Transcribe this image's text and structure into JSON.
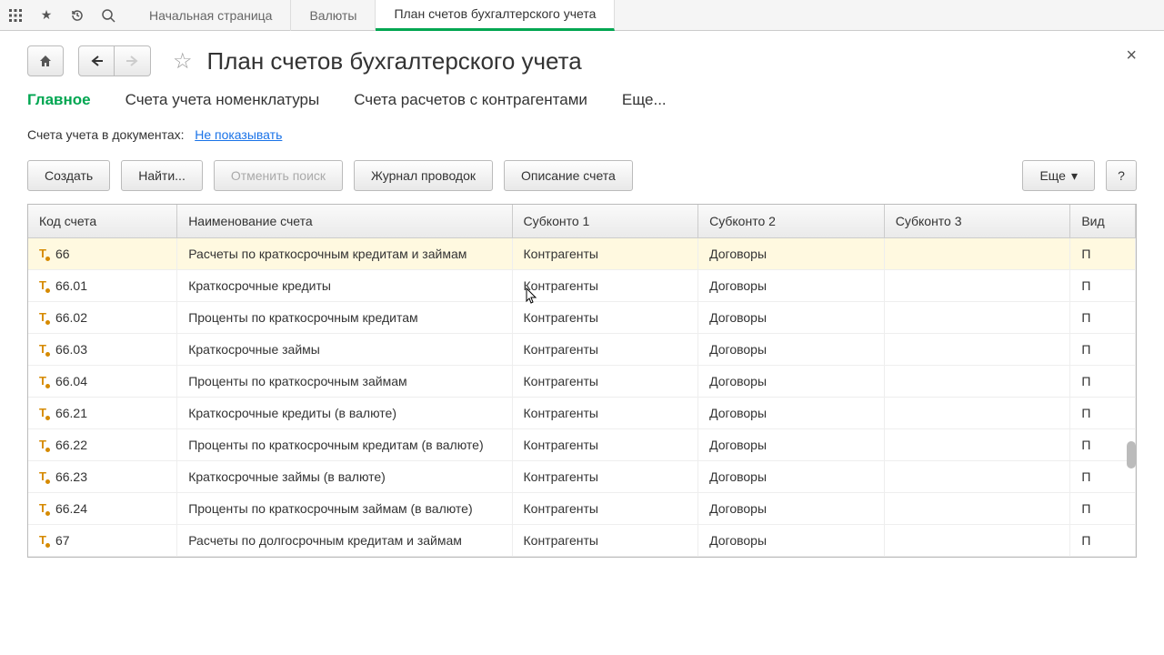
{
  "top_tabs": {
    "home": "Начальная страница",
    "currencies": "Валюты",
    "chart": "План счетов бухгалтерского учета"
  },
  "header": {
    "title": "План счетов бухгалтерского учета"
  },
  "page_tabs": {
    "main": "Главное",
    "nomenclature": "Счета учета номенклатуры",
    "counterparties": "Счета расчетов с контрагентами",
    "more": "Еще..."
  },
  "filter": {
    "label": "Счета учета в документах:",
    "link": "Не показывать"
  },
  "actions": {
    "create": "Создать",
    "find": "Найти...",
    "cancel_search": "Отменить поиск",
    "journal": "Журнал проводок",
    "description": "Описание счета",
    "more": "Еще",
    "help": "?"
  },
  "columns": {
    "code": "Код счета",
    "name": "Наименование счета",
    "sub1": "Субконто 1",
    "sub2": "Субконто 2",
    "sub3": "Субконто 3",
    "vid": "Вид"
  },
  "rows": [
    {
      "code": "66",
      "name": "Расчеты по краткосрочным кредитам и займам",
      "sub1": "Контрагенты",
      "sub2": "Договоры",
      "sub3": "",
      "vid": "П",
      "sel": true
    },
    {
      "code": "66.01",
      "name": "Краткосрочные кредиты",
      "sub1": "Контрагенты",
      "sub2": "Договоры",
      "sub3": "",
      "vid": "П"
    },
    {
      "code": "66.02",
      "name": "Проценты по краткосрочным кредитам",
      "sub1": "Контрагенты",
      "sub2": "Договоры",
      "sub3": "",
      "vid": "П"
    },
    {
      "code": "66.03",
      "name": "Краткосрочные займы",
      "sub1": "Контрагенты",
      "sub2": "Договоры",
      "sub3": "",
      "vid": "П"
    },
    {
      "code": "66.04",
      "name": "Проценты по краткосрочным займам",
      "sub1": "Контрагенты",
      "sub2": "Договоры",
      "sub3": "",
      "vid": "П"
    },
    {
      "code": "66.21",
      "name": "Краткосрочные кредиты (в валюте)",
      "sub1": "Контрагенты",
      "sub2": "Договоры",
      "sub3": "",
      "vid": "П"
    },
    {
      "code": "66.22",
      "name": "Проценты по краткосрочным кредитам (в валюте)",
      "sub1": "Контрагенты",
      "sub2": "Договоры",
      "sub3": "",
      "vid": "П"
    },
    {
      "code": "66.23",
      "name": "Краткосрочные займы (в валюте)",
      "sub1": "Контрагенты",
      "sub2": "Договоры",
      "sub3": "",
      "vid": "П"
    },
    {
      "code": "66.24",
      "name": "Проценты по краткосрочным займам (в валюте)",
      "sub1": "Контрагенты",
      "sub2": "Договоры",
      "sub3": "",
      "vid": "П"
    },
    {
      "code": "67",
      "name": "Расчеты по долгосрочным кредитам и займам",
      "sub1": "Контрагенты",
      "sub2": "Договоры",
      "sub3": "",
      "vid": "П"
    }
  ]
}
